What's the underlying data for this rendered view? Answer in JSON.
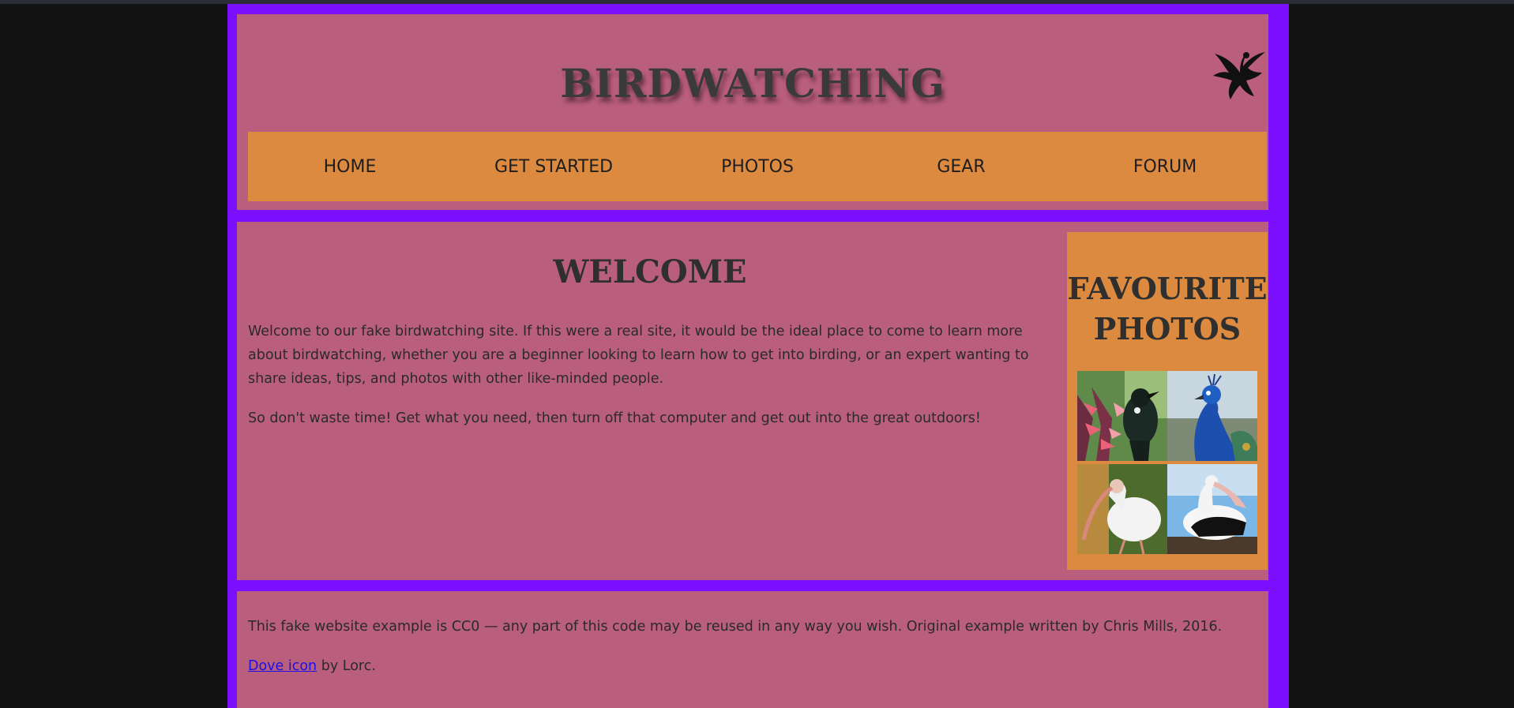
{
  "header": {
    "site_title": "BIRDWATCHING",
    "logo_icon": "dove-icon"
  },
  "nav": {
    "items": [
      {
        "label": "HOME"
      },
      {
        "label": "GET STARTED"
      },
      {
        "label": "PHOTOS"
      },
      {
        "label": "GEAR"
      },
      {
        "label": "FORUM"
      }
    ]
  },
  "main": {
    "title": "WELCOME",
    "paragraphs": [
      "Welcome to our fake birdwatching site. If this were a real site, it would be the ideal place to come to learn more about birdwatching, whether you are a beginner looking to learn how to get into birding, or an expert wanting to share ideas, tips, and photos with other like-minded people.",
      "So don't waste time! Get what you need, then turn off that computer and get out into the great outdoors!"
    ]
  },
  "aside": {
    "title": "FAVOURITE PHOTOS",
    "photos": [
      "tui-photo",
      "peacock-photo",
      "ibis-photo",
      "pelican-photo"
    ]
  },
  "footer": {
    "license_text": "This fake website example is CC0 — any part of this code may be reused in any way you wish. Original example written by Chris Mills, 2016.",
    "credit_link": "Dove icon",
    "credit_suffix": " by Lorc."
  },
  "colors": {
    "page_border": "#7d0fff",
    "panel_bg": "#ba5e7d",
    "accent_orange": "#dc8a40",
    "link": "#1a10e8"
  }
}
